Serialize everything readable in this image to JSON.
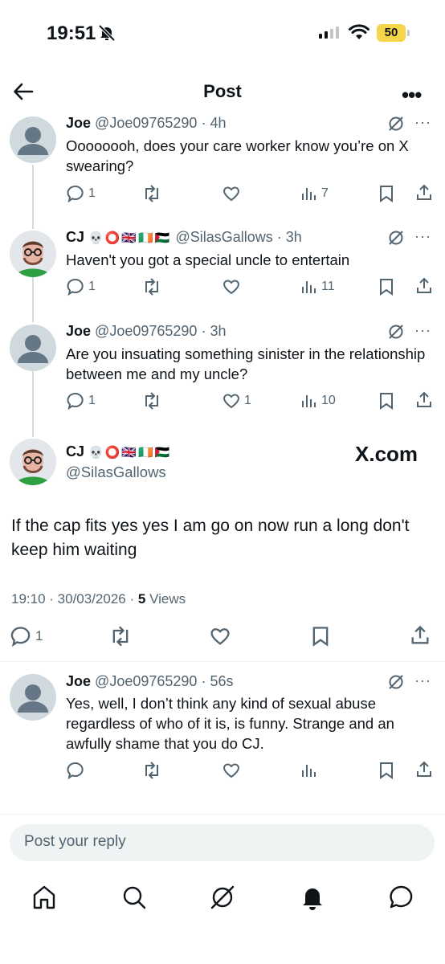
{
  "status_bar": {
    "time": "19:51",
    "battery": "50"
  },
  "header": {
    "title": "Post"
  },
  "replies_above": [
    {
      "name": "Joe",
      "handle": "@Joe09765290",
      "age": "4h",
      "text": "Oooooooh, does your care worker know you’re on X swearing?",
      "replies": "1",
      "reposts": "",
      "likes": "",
      "views": "7"
    },
    {
      "name": "CJ",
      "emojis": "💀⭕🇬🇧🇮🇪🇵🇸",
      "handle": "@SilasGallows",
      "age": "3h",
      "text": "Haven't you got a special uncle to entertain",
      "replies": "1",
      "reposts": "",
      "likes": "",
      "views": "11"
    },
    {
      "name": "Joe",
      "handle": "@Joe09765290",
      "age": "3h",
      "text": "Are you insuating something sinister in the relationship between me and my uncle?",
      "replies": "1",
      "reposts": "",
      "likes": "1",
      "views": "10"
    }
  ],
  "main_post": {
    "name": "CJ",
    "emojis": "💀⭕🇬🇧🇮🇪🇵🇸",
    "handle": "@SilasGallows",
    "watermark": "X.com",
    "text": "If the cap fits yes yes I am go on now run a long don't keep him waiting",
    "time": "19:10",
    "date": "30/03/2026",
    "views_count": "5",
    "views_label": "Views",
    "replies": "1"
  },
  "reply_below": {
    "name": "Joe",
    "handle": "@Joe09765290",
    "age": "56s",
    "text": "Yes, well, I don’t think any kind of sexual abuse regardless of who of it is, is funny. Strange and an awfully shame that you do CJ."
  },
  "composer": {
    "placeholder": "Post your reply"
  },
  "icons": [
    "back-arrow-icon",
    "more-icon",
    "grok-icon",
    "reply-icon",
    "repost-icon",
    "like-icon",
    "views-icon",
    "bookmark-icon",
    "share-icon",
    "home-icon",
    "search-icon",
    "notifications-icon",
    "messages-icon"
  ]
}
